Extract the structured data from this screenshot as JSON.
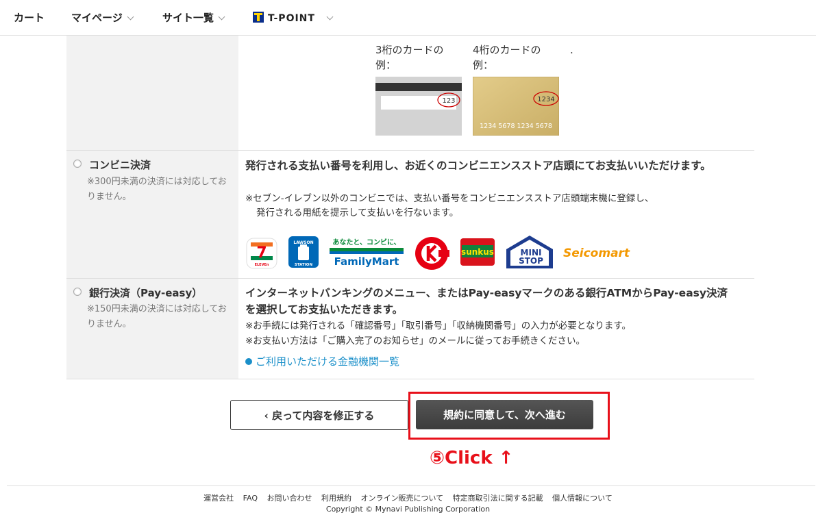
{
  "nav": {
    "cart": "カート",
    "mypage": "マイページ",
    "sites": "サイト一覧",
    "tpoint": "T-POINT"
  },
  "card_examples": {
    "three_digit_label": "3桁のカードの例：",
    "three_digit_code": "123",
    "four_digit_label": "4桁のカードの例：",
    "four_digit_code": "1234",
    "four_digit_number": "1234 5678 1234 5678",
    "trailing": "."
  },
  "convenience": {
    "title": "コンビニ決済",
    "note": "※300円未満の決済には対応しておりません。",
    "desc": "発行される支払い番号を利用し、お近くのコンビニエンスストア店頭にてお支払いいただけます。",
    "sub1": "※セブン-イレブン以外のコンビニでは、支払い番号をコンビニエンスストア店頭端末機に登録し、",
    "sub2": "発行される用紙を提示して支払いを行ないます。",
    "logos": {
      "familymart_top": "あなたと、コンビに、",
      "familymart": "FamilyMart",
      "lawson_top": "LAWSON",
      "lawson_bottom": "STATION",
      "seven_eleven": "ELEVEn",
      "sunkus": "sunkus",
      "ministop_1": "MINI",
      "ministop_2": "STOP",
      "seicomart": "Seicomart"
    }
  },
  "payeasy": {
    "title": "銀行決済（Pay-easy）",
    "note": "※150円未満の決済には対応しておりません。",
    "desc": "インターネットバンキングのメニュー、またはPay-easyマークのある銀行ATMからPay-easy決済を選択してお支払いただきます。",
    "sub1": "※お手続には発行される「確認番号」「取引番号」「収納機関番号」の入力が必要となります。",
    "sub2": "※お支払い方法は「ご購入完了のお知らせ」のメールに従ってお手続きください。",
    "link": "ご利用いただける金融機関一覧"
  },
  "buttons": {
    "back": "‹ 戻って内容を修正する",
    "next": "規約に同意して、次へ進む"
  },
  "annotation": "⑤Click ↑",
  "footer": {
    "links": [
      "運営会社",
      "FAQ",
      "お問い合わせ",
      "利用規約",
      "オンライン販売について",
      "特定商取引法に関する記載",
      "個人情報について"
    ],
    "copyright": "Copyright © Mynavi Publishing Corporation"
  },
  "colors": {
    "accent_red": "#e8101a",
    "link_blue": "#1a8fc9",
    "button_dark": "#444444"
  }
}
